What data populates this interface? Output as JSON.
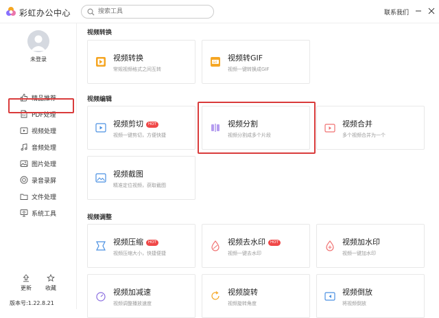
{
  "app": {
    "title": "彩虹办公中心",
    "contact": "联系我们",
    "accent": "#1677ff",
    "highlight": "#d93a3a"
  },
  "search": {
    "placeholder": "搜索工具"
  },
  "user": {
    "login": "未登录"
  },
  "sidebar": {
    "items": [
      {
        "label": "精品推荐",
        "icon": "thumbs-up-icon",
        "active": false
      },
      {
        "label": "PDF处理",
        "icon": "pdf-icon",
        "active": false
      },
      {
        "label": "视频处理",
        "icon": "video-icon",
        "active": true
      },
      {
        "label": "音频处理",
        "icon": "audio-icon",
        "active": false
      },
      {
        "label": "图片处理",
        "icon": "image-icon",
        "active": false
      },
      {
        "label": "录音录屏",
        "icon": "record-icon",
        "active": false
      },
      {
        "label": "文件处理",
        "icon": "folder-icon",
        "active": false
      },
      {
        "label": "系统工具",
        "icon": "system-icon",
        "active": false
      }
    ],
    "update": "更新",
    "favorite": "收藏",
    "version": "版本号:1.22.8.21"
  },
  "sections": [
    {
      "title": "视频转换",
      "cards": [
        {
          "title": "视频转换",
          "desc": "常规视频格式之间互转",
          "hot": false
        },
        {
          "title": "视频转GIF",
          "desc": "视频一键转换成GIF",
          "hot": false
        }
      ]
    },
    {
      "title": "视频编辑",
      "cards": [
        {
          "title": "视频剪切",
          "desc": "视频一键剪切，方便快捷",
          "hot": true
        },
        {
          "title": "视频分割",
          "desc": "视频分割成多个片段",
          "hot": false
        },
        {
          "title": "视频合并",
          "desc": "多个视频合并为一个",
          "hot": false
        },
        {
          "title": "视频截图",
          "desc": "精准定位视频，获取截图",
          "hot": false
        }
      ]
    },
    {
      "title": "视频调整",
      "cards": [
        {
          "title": "视频压缩",
          "desc": "视频压缩大小，快捷便捷",
          "hot": true
        },
        {
          "title": "视频去水印",
          "desc": "视频一键去水印",
          "hot": true
        },
        {
          "title": "视频加水印",
          "desc": "视频一键加水印",
          "hot": false
        },
        {
          "title": "视频加减速",
          "desc": "视频调整播放速度",
          "hot": false
        },
        {
          "title": "视频旋转",
          "desc": "视频旋转角度",
          "hot": false
        },
        {
          "title": "视频倒放",
          "desc": "将视频倒放",
          "hot": false
        }
      ]
    }
  ],
  "hot_label": "HOT"
}
